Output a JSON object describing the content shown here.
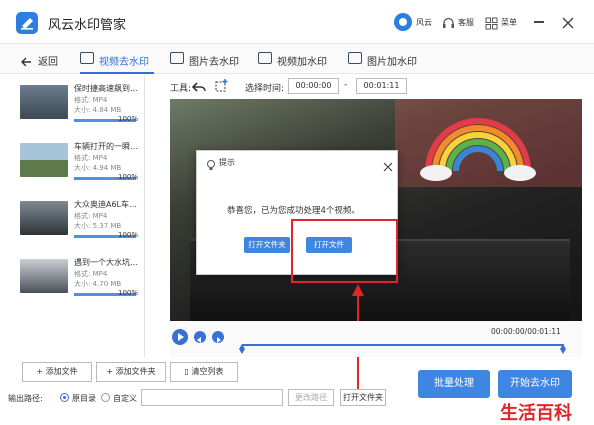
{
  "app": {
    "title": "风云水印管家",
    "accent": "#3f86e3"
  },
  "header": {
    "user_label": "风云",
    "service_label": "客服",
    "menu_label": "菜单"
  },
  "nav": {
    "back_label": "返回",
    "tabs": [
      {
        "label": "视频去水印",
        "active": true
      },
      {
        "label": "图片去水印",
        "active": false
      },
      {
        "label": "视频加水印",
        "active": false
      },
      {
        "label": "图片加水印",
        "active": false
      }
    ]
  },
  "toolbar": {
    "tools_label": "工具:",
    "select_time_label": "选择时间:",
    "start_time": "00:00:00",
    "separator": "-",
    "end_time": "00:01:11"
  },
  "files": [
    {
      "name": "保时捷高速飙到…",
      "format": "格式: MP4",
      "size": "大小: 4.84 MB",
      "progress": "100%"
    },
    {
      "name": "车辆打开的一瞬…",
      "format": "格式: MP4",
      "size": "大小: 4.94 MB",
      "progress": "100%"
    },
    {
      "name": "大众奥迪A6L车…",
      "format": "格式: MP4",
      "size": "大小: 5.37 MB",
      "progress": "100%"
    },
    {
      "name": "遇到一个大水坑…",
      "format": "格式: MP4",
      "size": "大小: 4.70 MB",
      "progress": "100%"
    }
  ],
  "dialog": {
    "title": "提示",
    "message": "恭喜您，已为您成功处理4个视频。",
    "open_folder_label": "打开文件夹",
    "open_file_label": "打开文件"
  },
  "player": {
    "time": "00:00:00/00:01:11"
  },
  "bottom": {
    "add_file_label": "添加文件",
    "add_folder_label": "添加文件夹",
    "clear_list_label": "清空列表",
    "output_label": "输出路径:",
    "original_dir_label": "原目录",
    "custom_label": "自定义",
    "path_value": "",
    "change_path_label": "更改路径",
    "open_folder_label": "打开文件夹",
    "batch_label": "批量处理",
    "start_label": "开始去水印"
  },
  "watermark": {
    "text": "生活百科"
  }
}
